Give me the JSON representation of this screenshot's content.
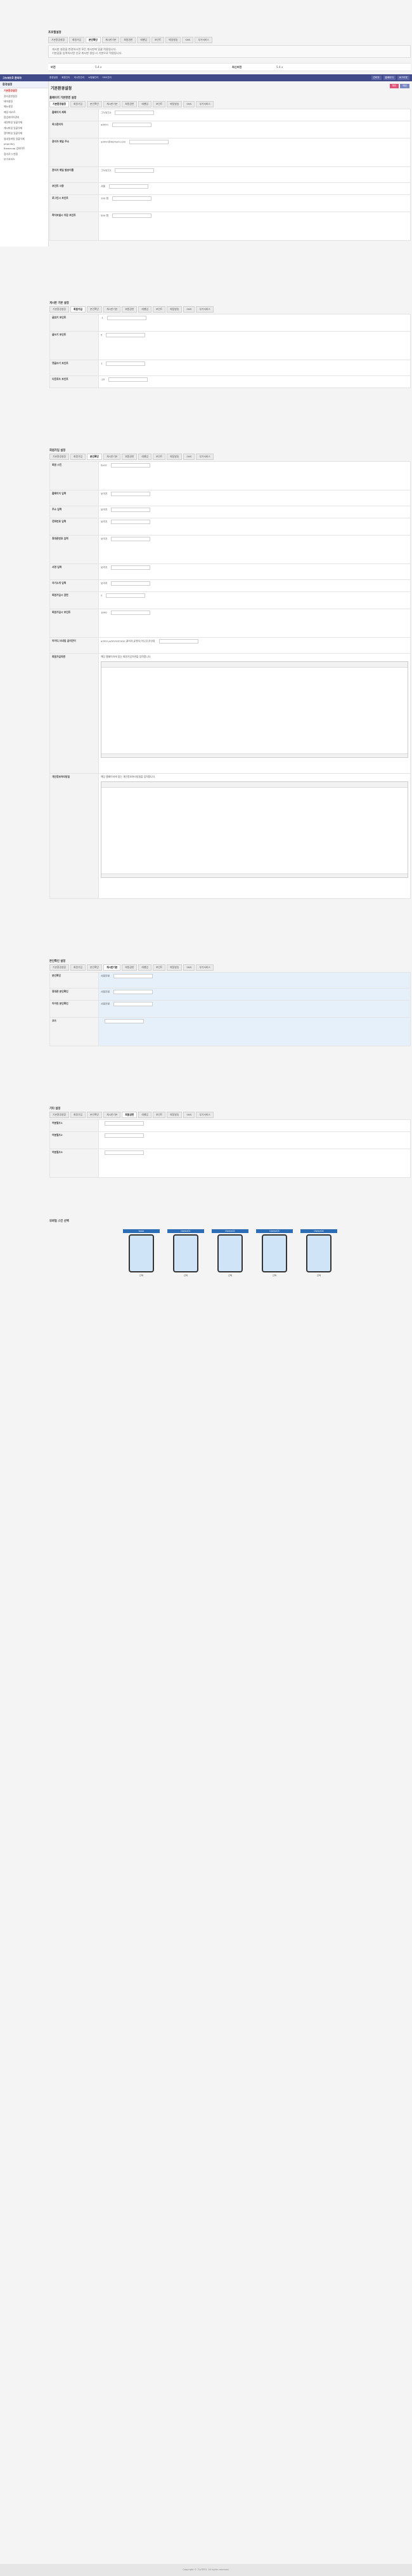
{
  "notice": {
    "title": "프로필설정",
    "tabs": [
      "기본환경설정",
      "회원가입",
      "본인확인",
      "게시판기본",
      "회원권한",
      "레벨업",
      "포인트",
      "메일발송",
      "SMS",
      "부가서비스"
    ],
    "text1": "게시판 설정을 변경하시면 모든 게시판에 일괄 적용됩니다.",
    "text2": "기본값을 입력하시면 신규 게시판 생성 시 기본으로 적용됩니다.",
    "row_label": "버전",
    "row_value": "5.4.x",
    "row_label2": "최신버전",
    "row_value2": "5.4.x"
  },
  "topbar": {
    "brand": "그누보드5 관리자",
    "menu": [
      "환경설정",
      "회원관리",
      "게시판관리",
      "쇼핑몰관리",
      "SMS관리"
    ],
    "right": [
      "관리자",
      "홈페이지",
      "로그아웃"
    ]
  },
  "sidebar": {
    "header": "환경설정",
    "items": [
      "기본환경설정",
      "관리권한설정",
      "테마설정",
      "메뉴설정",
      "메일 테스트",
      "팝업레이어관리",
      "세션파일 일괄삭제",
      "캐시파일 일괄삭제",
      "캡챠파일 일괄삭제",
      "썸네일파일 일괄삭제",
      "phpinfo()",
      "Browscap 업데이트",
      "접속로그 변환",
      "부가서비스"
    ]
  },
  "main": {
    "title": "기본환경설정",
    "btn_save": "확인",
    "btn_home": "메인",
    "sections": [
      {
        "title": "홈페이지 기본환경 설정",
        "rows": [
          {
            "label": "홈페이지 제목",
            "value": "그누보드5"
          },
          {
            "label": "최고관리자",
            "value": "admin"
          },
          {
            "label": "관리자 메일 주소",
            "value": "admin@domain.com"
          },
          {
            "label": "관리자 메일 발송이름",
            "value": "그누보드5"
          },
          {
            "label": "포인트 사용",
            "value": "사용"
          },
          {
            "label": "로그인시 포인트",
            "value": "100 점"
          },
          {
            "label": "쪽지보낼시 차감 포인트",
            "value": "500 점"
          }
        ]
      },
      {
        "title": "게시판 기본 설정",
        "rows": [
          {
            "label": "글읽기 포인트",
            "value": "-1"
          },
          {
            "label": "글쓰기 포인트",
            "value": "5"
          },
          {
            "label": "댓글쓰기 포인트",
            "value": "1"
          },
          {
            "label": "다운로드 포인트",
            "value": "-20"
          }
        ]
      },
      {
        "title": "회원가입 설정",
        "rows": [
          {
            "label": "회원 스킨",
            "value": "basic"
          },
          {
            "label": "홈페이지 입력",
            "value": "보이기"
          },
          {
            "label": "주소 입력",
            "value": "보이기"
          },
          {
            "label": "전화번호 입력",
            "value": "보이기"
          },
          {
            "label": "휴대폰번호 입력",
            "value": "보이기"
          },
          {
            "label": "서명 입력",
            "value": "보이기"
          },
          {
            "label": "자기소개 입력",
            "value": "보이기"
          },
          {
            "label": "회원가입시 권한",
            "value": "2"
          },
          {
            "label": "회원가입시 포인트",
            "value": "1000"
          },
          {
            "label": "아이디,닉네임 금지단어",
            "value": "admin,administrator,관리자,운영자,어드민,주인장"
          },
          {
            "label": "회원가입약관",
            "value": "해당 홈페이지에 맞는 회원가입약관을 입력합니다."
          },
          {
            "label": "개인정보처리방침",
            "value": "해당 홈페이지에 맞는 개인정보처리방침을 입력합니다."
          }
        ]
      },
      {
        "title": "본인확인 설정",
        "rows": [
          {
            "label": "본인확인",
            "value": "사용안함"
          },
          {
            "label": "휴대폰 본인확인",
            "value": "사용안함"
          },
          {
            "label": "아이핀 본인확인",
            "value": "사용안함"
          },
          {
            "label": "코드",
            "value": ""
          }
        ]
      },
      {
        "title": "기타 설정",
        "rows": [
          {
            "label": "여분필드1",
            "value": ""
          },
          {
            "label": "여분필드2",
            "value": ""
          },
          {
            "label": "여분필드3",
            "value": ""
          }
        ]
      }
    ],
    "skins_title": "모바일 스킨 선택",
    "skins": [
      "basic",
      "theme01",
      "theme02",
      "theme03",
      "theme04"
    ],
    "skin_caption": "선택"
  },
  "footer": "Copyright © 그누보드5. All rights reserved."
}
